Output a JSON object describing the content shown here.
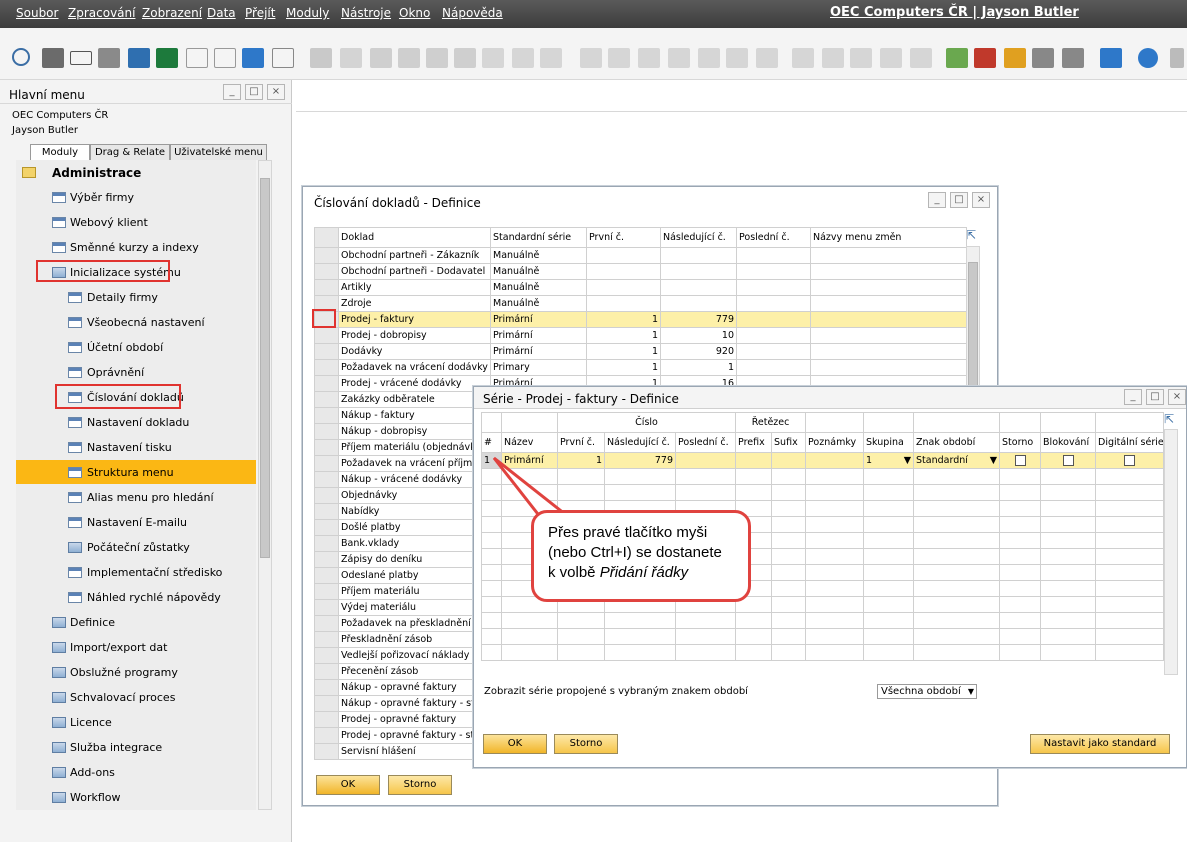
{
  "menubar": {
    "items": [
      "Soubor",
      "Zpracování",
      "Zobrazení",
      "Data",
      "Přejít",
      "Moduly",
      "Nástroje",
      "Okno",
      "Nápověda"
    ],
    "company": "OEC Computers ČR | Jayson Butler"
  },
  "main_menu": {
    "title": "Hlavní menu",
    "company_line": "OEC Computers ČR",
    "user_line": "Jayson Butler",
    "tabs": [
      "Moduly",
      "Drag & Relate",
      "Uživatelské menu"
    ],
    "section": "Administrace",
    "items": [
      "Výběr firmy",
      "Webový klient",
      "Směnné kurzy a indexy",
      "Inicializace systému",
      "Detaily firmy",
      "Všeobecná nastavení",
      "Účetní období",
      "Oprávnění",
      "Číslování dokladů",
      "Nastavení dokladu",
      "Nastavení tisku",
      "Struktura menu",
      "Alias menu pro hledání",
      "Nastavení E-mailu",
      "Počáteční zůstatky",
      "Implementační středisko",
      "Náhled rychlé nápovědy",
      "Definice",
      "Import/export dat",
      "Obslužné programy",
      "Schvalovací proces",
      "Licence",
      "Služba integrace",
      "Add-ons",
      "Workflow"
    ],
    "selected": "Struktura menu"
  },
  "doc_window": {
    "title": "Číslování dokladů - Definice",
    "columns": [
      "Doklad",
      "Standardní série",
      "První č.",
      "Následující č.",
      "Poslední č.",
      "Názvy menu změn"
    ],
    "rows": [
      [
        "Obchodní partneři - Zákazník",
        "Manuálně",
        "",
        "",
        "",
        ""
      ],
      [
        "Obchodní partneři - Dodavatel",
        "Manuálně",
        "",
        "",
        "",
        ""
      ],
      [
        "Artikly",
        "Manuálně",
        "",
        "",
        "",
        ""
      ],
      [
        "Zdroje",
        "Manuálně",
        "",
        "",
        "",
        ""
      ],
      [
        "Prodej - faktury",
        "Primární",
        "1",
        "779",
        "",
        ""
      ],
      [
        "Prodej - dobropisy",
        "Primární",
        "1",
        "10",
        "",
        ""
      ],
      [
        "Dodávky",
        "Primární",
        "1",
        "920",
        "",
        ""
      ],
      [
        "Požadavek na vrácení dodávky",
        "Primary",
        "1",
        "1",
        "",
        ""
      ],
      [
        "Prodej - vrácené dodávky",
        "Primární",
        "1",
        "16",
        "",
        ""
      ],
      [
        "Zakázky odběratele",
        "",
        "",
        "",
        "",
        ""
      ],
      [
        "Nákup - faktury",
        "",
        "",
        "",
        "",
        ""
      ],
      [
        "Nákup - dobropisy",
        "",
        "",
        "",
        "",
        ""
      ],
      [
        "Příjem materiálu (objednávka",
        "",
        "",
        "",
        "",
        ""
      ],
      [
        "Požadavek na vrácení příjmu",
        "",
        "",
        "",
        "",
        ""
      ],
      [
        "Nákup - vrácené dodávky",
        "",
        "",
        "",
        "",
        ""
      ],
      [
        "Objednávky",
        "",
        "",
        "",
        "",
        ""
      ],
      [
        "Nabídky",
        "",
        "",
        "",
        "",
        ""
      ],
      [
        "Došlé platby",
        "",
        "",
        "",
        "",
        ""
      ],
      [
        "Bank.vklady",
        "",
        "",
        "",
        "",
        ""
      ],
      [
        "Zápisy do deníku",
        "",
        "",
        "",
        "",
        ""
      ],
      [
        "Odeslané platby",
        "",
        "",
        "",
        "",
        ""
      ],
      [
        "Příjem materiálu",
        "",
        "",
        "",
        "",
        ""
      ],
      [
        "Výdej materiálu",
        "",
        "",
        "",
        "",
        ""
      ],
      [
        "Požadavek na přeskladnění z",
        "",
        "",
        "",
        "",
        ""
      ],
      [
        "Přeskladnění zásob",
        "",
        "",
        "",
        "",
        ""
      ],
      [
        "Vedlejší pořizovací náklady",
        "",
        "",
        "",
        "",
        ""
      ],
      [
        "Přecenění zásob",
        "",
        "",
        "",
        "",
        ""
      ],
      [
        "Nákup - opravné faktury",
        "",
        "",
        "",
        "",
        ""
      ],
      [
        "Nákup - opravné faktury - st",
        "",
        "",
        "",
        "",
        ""
      ],
      [
        "Prodej - opravné faktury",
        "",
        "",
        "",
        "",
        ""
      ],
      [
        "Prodej - opravné faktury - st",
        "",
        "",
        "",
        "",
        ""
      ],
      [
        "Servisní hlášení",
        "",
        "",
        "",
        "",
        ""
      ]
    ],
    "ok": "OK",
    "cancel": "Storno"
  },
  "series_window": {
    "title": "Série - Prodej - faktury - Definice",
    "group_cislo": "Číslo",
    "group_retezec": "Řetězec",
    "columns": [
      "#",
      "Název",
      "První č.",
      "Následující č.",
      "Poslední č.",
      "Prefix",
      "Sufix",
      "Poznámky",
      "Skupina",
      "Znak období",
      "Storno",
      "Blokování",
      "Digitální série"
    ],
    "row": {
      "num": "1",
      "name": "Primární",
      "first": "1",
      "next": "779",
      "last": "",
      "prefix": "",
      "suffix": "",
      "notes": "",
      "group": "1",
      "period": "Standardní"
    },
    "filter_label": "Zobrazit série propojené s vybraným znakem období",
    "filter_value": "Všechna období",
    "ok": "OK",
    "cancel": "Storno",
    "set_default": "Nastavit jako standard"
  },
  "callout": {
    "line1": "Přes pravé tlačítko myši",
    "line2": "(nebo Ctrl+I) se dostanete",
    "line3": "k volbě ",
    "line3_em": "Přidání řádky"
  },
  "colors": {
    "accent": "#fbb714",
    "highlight": "#fdf0a8",
    "red": "#e0332f"
  }
}
